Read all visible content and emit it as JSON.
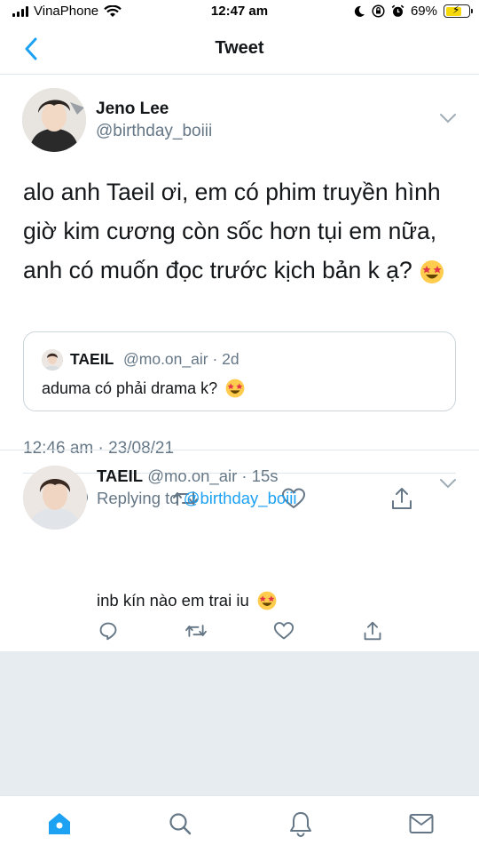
{
  "status_bar": {
    "carrier": "VinaPhone",
    "time": "12:47 am",
    "battery": "69%"
  },
  "nav": {
    "title": "Tweet"
  },
  "tweet": {
    "author_name": "Jeno Lee",
    "author_handle": "@birthday_boiii",
    "text": "alo anh Taeil ơi, em có phim truyền hình giờ kim cương còn sốc hơn tụi em nữa, anh có muốn đọc trước kịch bản k ạ?",
    "quote": {
      "name": "TAEIL",
      "handle_time": "@mo.on_air · 2d",
      "text": "aduma có phải drama k?"
    },
    "timestamp": "12:46 am · 23/08/21"
  },
  "reply": {
    "name": "TAEIL",
    "handle_time": "@mo.on_air · 15s",
    "replying_label": "Replying to",
    "replying_to": "@birthday_boiii",
    "text": "inb kín nào em trai iu"
  },
  "tabbar": {
    "items": [
      "home-icon",
      "search-icon",
      "notifications-icon",
      "messages-icon"
    ]
  },
  "colors": {
    "accent": "#1da1f2",
    "secondary_text": "#657786",
    "divider": "#e1e8ed",
    "background_fill": "#e6ecf0",
    "emoji": "#ffcc4d"
  }
}
